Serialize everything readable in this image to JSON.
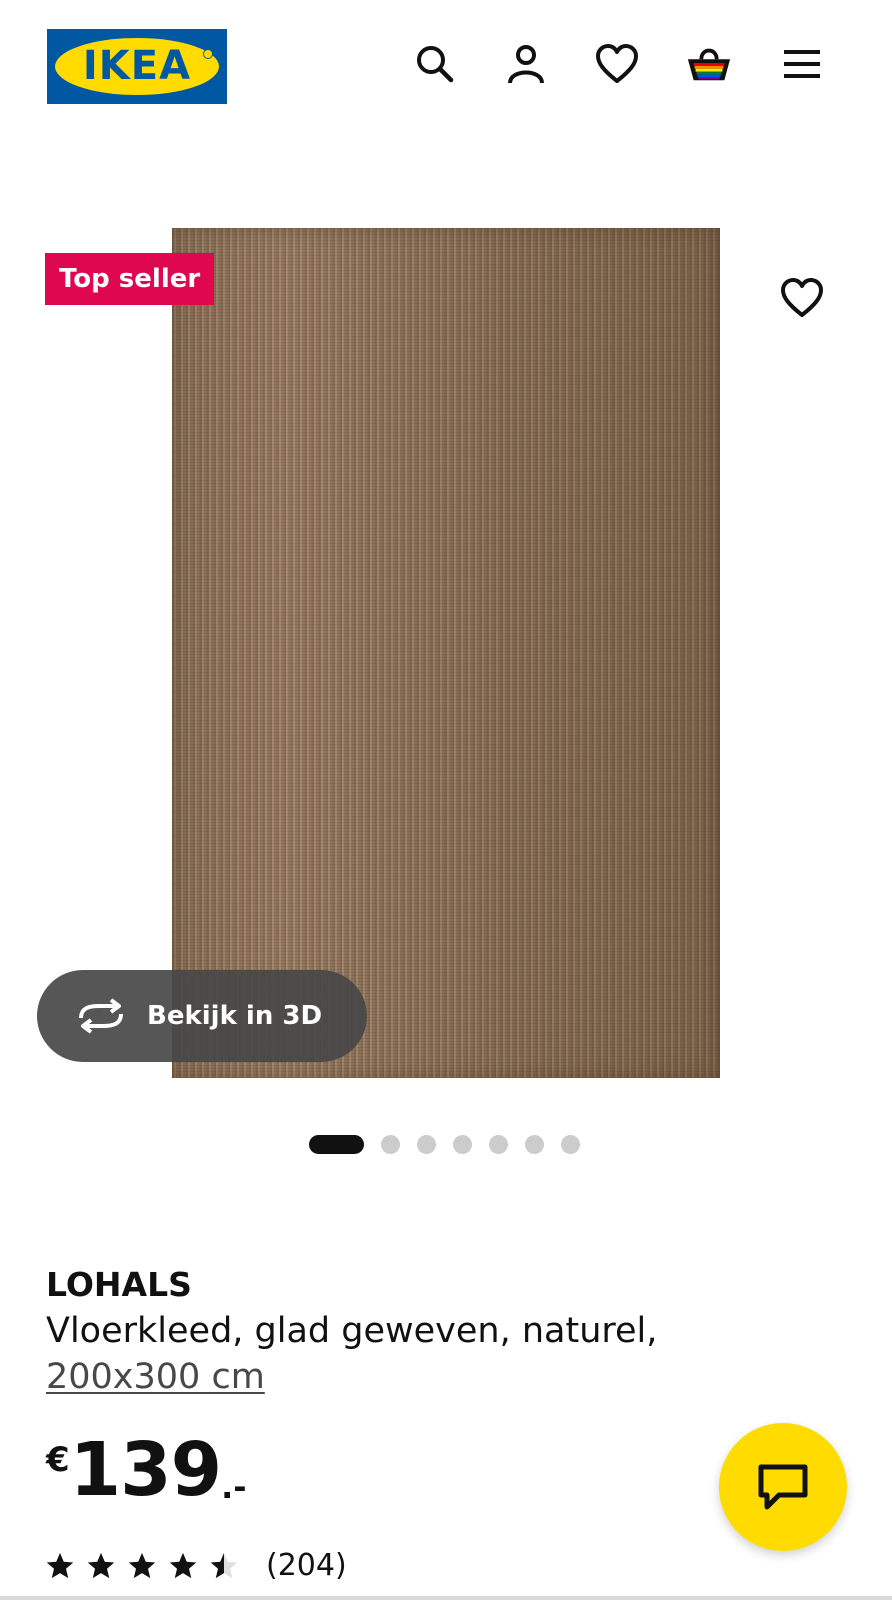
{
  "header": {
    "logo_text": "IKEA",
    "icons": [
      "search-icon",
      "user-icon",
      "heart-icon",
      "basket-icon",
      "menu-icon"
    ]
  },
  "gallery": {
    "badge": "Top seller",
    "view3d_label": "Bekijk in 3D",
    "slide_count": 7,
    "active_slide": 1
  },
  "product": {
    "name": "LOHALS",
    "description": "Vloerkleed, glad geweven, naturel,",
    "size": "200x300 cm",
    "price_currency": "€",
    "price_amount": "139",
    "price_decimals": ".-",
    "rating": 4.5,
    "review_count": "(204)"
  },
  "colors": {
    "brand_blue": "#0058a3",
    "brand_yellow": "#ffdb00",
    "badge_red": "#e00751"
  }
}
